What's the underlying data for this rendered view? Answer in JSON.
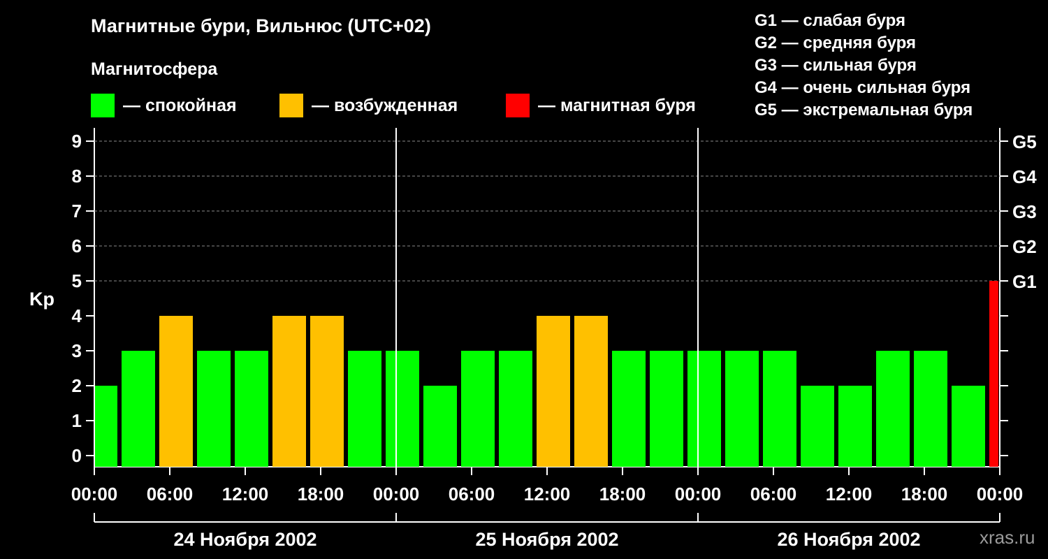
{
  "title": "Магнитные бури, Вильнюс (UTC+02)",
  "subtitle": "Магнитосфера",
  "legend": [
    {
      "label": "— спокойная",
      "color": "#00ff00"
    },
    {
      "label": "— возбужденная",
      "color": "#ffc000"
    },
    {
      "label": "— магнитная буря",
      "color": "#ff0000"
    }
  ],
  "g_scale": [
    "G1 — слабая буря",
    "G2 — средняя буря",
    "G3 — сильная буря",
    "G4 — очень сильная буря",
    "G5 — экстремальная буря"
  ],
  "watermark": "xras.ru",
  "chart_data": {
    "type": "bar",
    "ylabel": "Kp",
    "ylim": [
      0,
      9
    ],
    "y_ticks": [
      "0",
      "1",
      "2",
      "3",
      "4",
      "5",
      "6",
      "7",
      "8",
      "9"
    ],
    "right_ticks": [
      {
        "y": 5,
        "label": "G1"
      },
      {
        "y": 6,
        "label": "G2"
      },
      {
        "y": 7,
        "label": "G3"
      },
      {
        "y": 8,
        "label": "G4"
      },
      {
        "y": 9,
        "label": "G5"
      }
    ],
    "x_tick_labels": [
      "00:00",
      "06:00",
      "12:00",
      "18:00",
      "00:00",
      "06:00",
      "12:00",
      "18:00",
      "00:00",
      "06:00",
      "12:00",
      "18:00",
      "00:00"
    ],
    "days": [
      "24 Ноября 2002",
      "25 Ноября 2002",
      "26 Ноября 2002"
    ],
    "grid": true,
    "series": [
      {
        "values": [
          2,
          3,
          4,
          3,
          3,
          4,
          4,
          3,
          3,
          2,
          3,
          3,
          4,
          4,
          3,
          3,
          3,
          3,
          3,
          2,
          2,
          3,
          3,
          2,
          5
        ]
      }
    ],
    "colors": {
      "quiet": "#00ff00",
      "active": "#ffc000",
      "storm": "#ff0000"
    }
  }
}
